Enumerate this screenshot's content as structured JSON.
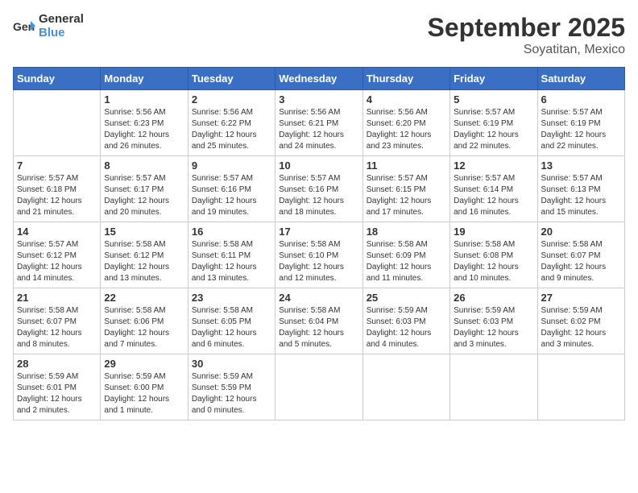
{
  "header": {
    "logo_general": "General",
    "logo_blue": "Blue",
    "month_year": "September 2025",
    "location": "Soyatitan, Mexico"
  },
  "days_of_week": [
    "Sunday",
    "Monday",
    "Tuesday",
    "Wednesday",
    "Thursday",
    "Friday",
    "Saturday"
  ],
  "weeks": [
    [
      {
        "day": "",
        "info": ""
      },
      {
        "day": "1",
        "info": "Sunrise: 5:56 AM\nSunset: 6:23 PM\nDaylight: 12 hours\nand 26 minutes."
      },
      {
        "day": "2",
        "info": "Sunrise: 5:56 AM\nSunset: 6:22 PM\nDaylight: 12 hours\nand 25 minutes."
      },
      {
        "day": "3",
        "info": "Sunrise: 5:56 AM\nSunset: 6:21 PM\nDaylight: 12 hours\nand 24 minutes."
      },
      {
        "day": "4",
        "info": "Sunrise: 5:56 AM\nSunset: 6:20 PM\nDaylight: 12 hours\nand 23 minutes."
      },
      {
        "day": "5",
        "info": "Sunrise: 5:57 AM\nSunset: 6:19 PM\nDaylight: 12 hours\nand 22 minutes."
      },
      {
        "day": "6",
        "info": "Sunrise: 5:57 AM\nSunset: 6:19 PM\nDaylight: 12 hours\nand 22 minutes."
      }
    ],
    [
      {
        "day": "7",
        "info": "Sunrise: 5:57 AM\nSunset: 6:18 PM\nDaylight: 12 hours\nand 21 minutes."
      },
      {
        "day": "8",
        "info": "Sunrise: 5:57 AM\nSunset: 6:17 PM\nDaylight: 12 hours\nand 20 minutes."
      },
      {
        "day": "9",
        "info": "Sunrise: 5:57 AM\nSunset: 6:16 PM\nDaylight: 12 hours\nand 19 minutes."
      },
      {
        "day": "10",
        "info": "Sunrise: 5:57 AM\nSunset: 6:16 PM\nDaylight: 12 hours\nand 18 minutes."
      },
      {
        "day": "11",
        "info": "Sunrise: 5:57 AM\nSunset: 6:15 PM\nDaylight: 12 hours\nand 17 minutes."
      },
      {
        "day": "12",
        "info": "Sunrise: 5:57 AM\nSunset: 6:14 PM\nDaylight: 12 hours\nand 16 minutes."
      },
      {
        "day": "13",
        "info": "Sunrise: 5:57 AM\nSunset: 6:13 PM\nDaylight: 12 hours\nand 15 minutes."
      }
    ],
    [
      {
        "day": "14",
        "info": "Sunrise: 5:57 AM\nSunset: 6:12 PM\nDaylight: 12 hours\nand 14 minutes."
      },
      {
        "day": "15",
        "info": "Sunrise: 5:58 AM\nSunset: 6:12 PM\nDaylight: 12 hours\nand 13 minutes."
      },
      {
        "day": "16",
        "info": "Sunrise: 5:58 AM\nSunset: 6:11 PM\nDaylight: 12 hours\nand 13 minutes."
      },
      {
        "day": "17",
        "info": "Sunrise: 5:58 AM\nSunset: 6:10 PM\nDaylight: 12 hours\nand 12 minutes."
      },
      {
        "day": "18",
        "info": "Sunrise: 5:58 AM\nSunset: 6:09 PM\nDaylight: 12 hours\nand 11 minutes."
      },
      {
        "day": "19",
        "info": "Sunrise: 5:58 AM\nSunset: 6:08 PM\nDaylight: 12 hours\nand 10 minutes."
      },
      {
        "day": "20",
        "info": "Sunrise: 5:58 AM\nSunset: 6:07 PM\nDaylight: 12 hours\nand 9 minutes."
      }
    ],
    [
      {
        "day": "21",
        "info": "Sunrise: 5:58 AM\nSunset: 6:07 PM\nDaylight: 12 hours\nand 8 minutes."
      },
      {
        "day": "22",
        "info": "Sunrise: 5:58 AM\nSunset: 6:06 PM\nDaylight: 12 hours\nand 7 minutes."
      },
      {
        "day": "23",
        "info": "Sunrise: 5:58 AM\nSunset: 6:05 PM\nDaylight: 12 hours\nand 6 minutes."
      },
      {
        "day": "24",
        "info": "Sunrise: 5:58 AM\nSunset: 6:04 PM\nDaylight: 12 hours\nand 5 minutes."
      },
      {
        "day": "25",
        "info": "Sunrise: 5:59 AM\nSunset: 6:03 PM\nDaylight: 12 hours\nand 4 minutes."
      },
      {
        "day": "26",
        "info": "Sunrise: 5:59 AM\nSunset: 6:03 PM\nDaylight: 12 hours\nand 3 minutes."
      },
      {
        "day": "27",
        "info": "Sunrise: 5:59 AM\nSunset: 6:02 PM\nDaylight: 12 hours\nand 3 minutes."
      }
    ],
    [
      {
        "day": "28",
        "info": "Sunrise: 5:59 AM\nSunset: 6:01 PM\nDaylight: 12 hours\nand 2 minutes."
      },
      {
        "day": "29",
        "info": "Sunrise: 5:59 AM\nSunset: 6:00 PM\nDaylight: 12 hours\nand 1 minute."
      },
      {
        "day": "30",
        "info": "Sunrise: 5:59 AM\nSunset: 5:59 PM\nDaylight: 12 hours\nand 0 minutes."
      },
      {
        "day": "",
        "info": ""
      },
      {
        "day": "",
        "info": ""
      },
      {
        "day": "",
        "info": ""
      },
      {
        "day": "",
        "info": ""
      }
    ]
  ]
}
